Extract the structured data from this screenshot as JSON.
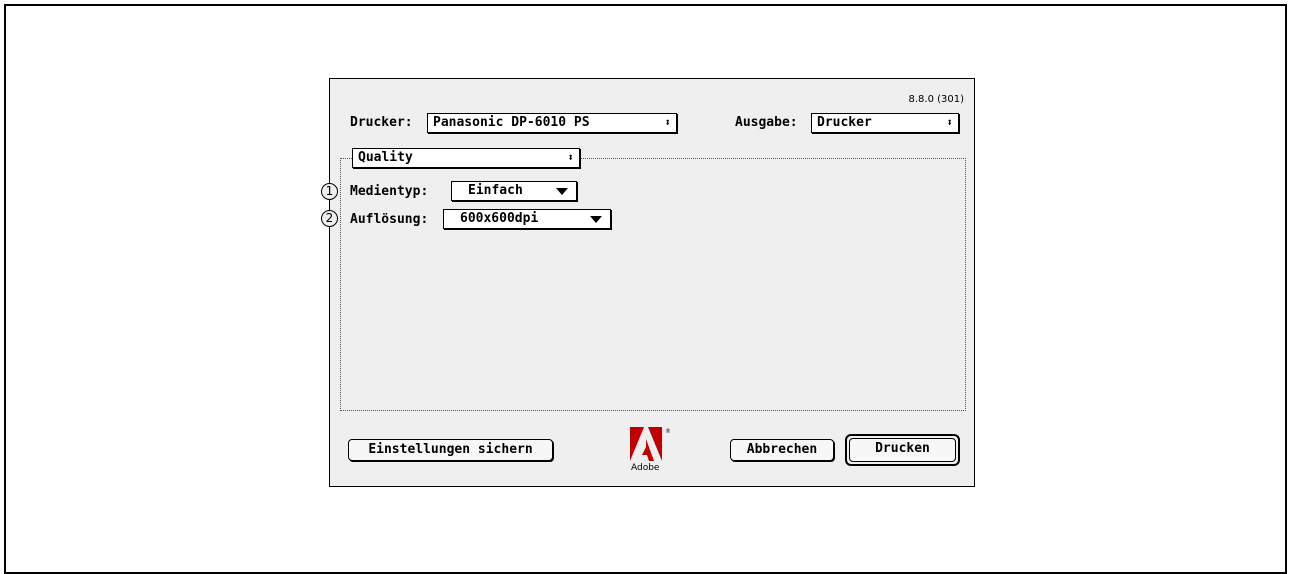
{
  "dialog": {
    "version": "8.8.0 (301)",
    "printer_label": "Drucker:",
    "printer_value": "Panasonic DP-6010 PS",
    "output_label": "Ausgabe:",
    "output_value": "Drucker",
    "panel_value": "Quality",
    "media_type": {
      "callout": "1",
      "label": "Medientyp:",
      "value": "Einfach"
    },
    "resolution": {
      "callout": "2",
      "label": "Auflösung:",
      "value": "600x600dpi"
    },
    "buttons": {
      "save_settings": "Einstellungen sichern",
      "cancel": "Abbrechen",
      "print": "Drucken"
    },
    "logo_text": "Adobe",
    "logo_registered": "®"
  },
  "icons": {
    "popup_arrows": "up-down-arrows-icon",
    "dropdown": "triangle-down-icon",
    "logo": "adobe-logo-icon"
  }
}
